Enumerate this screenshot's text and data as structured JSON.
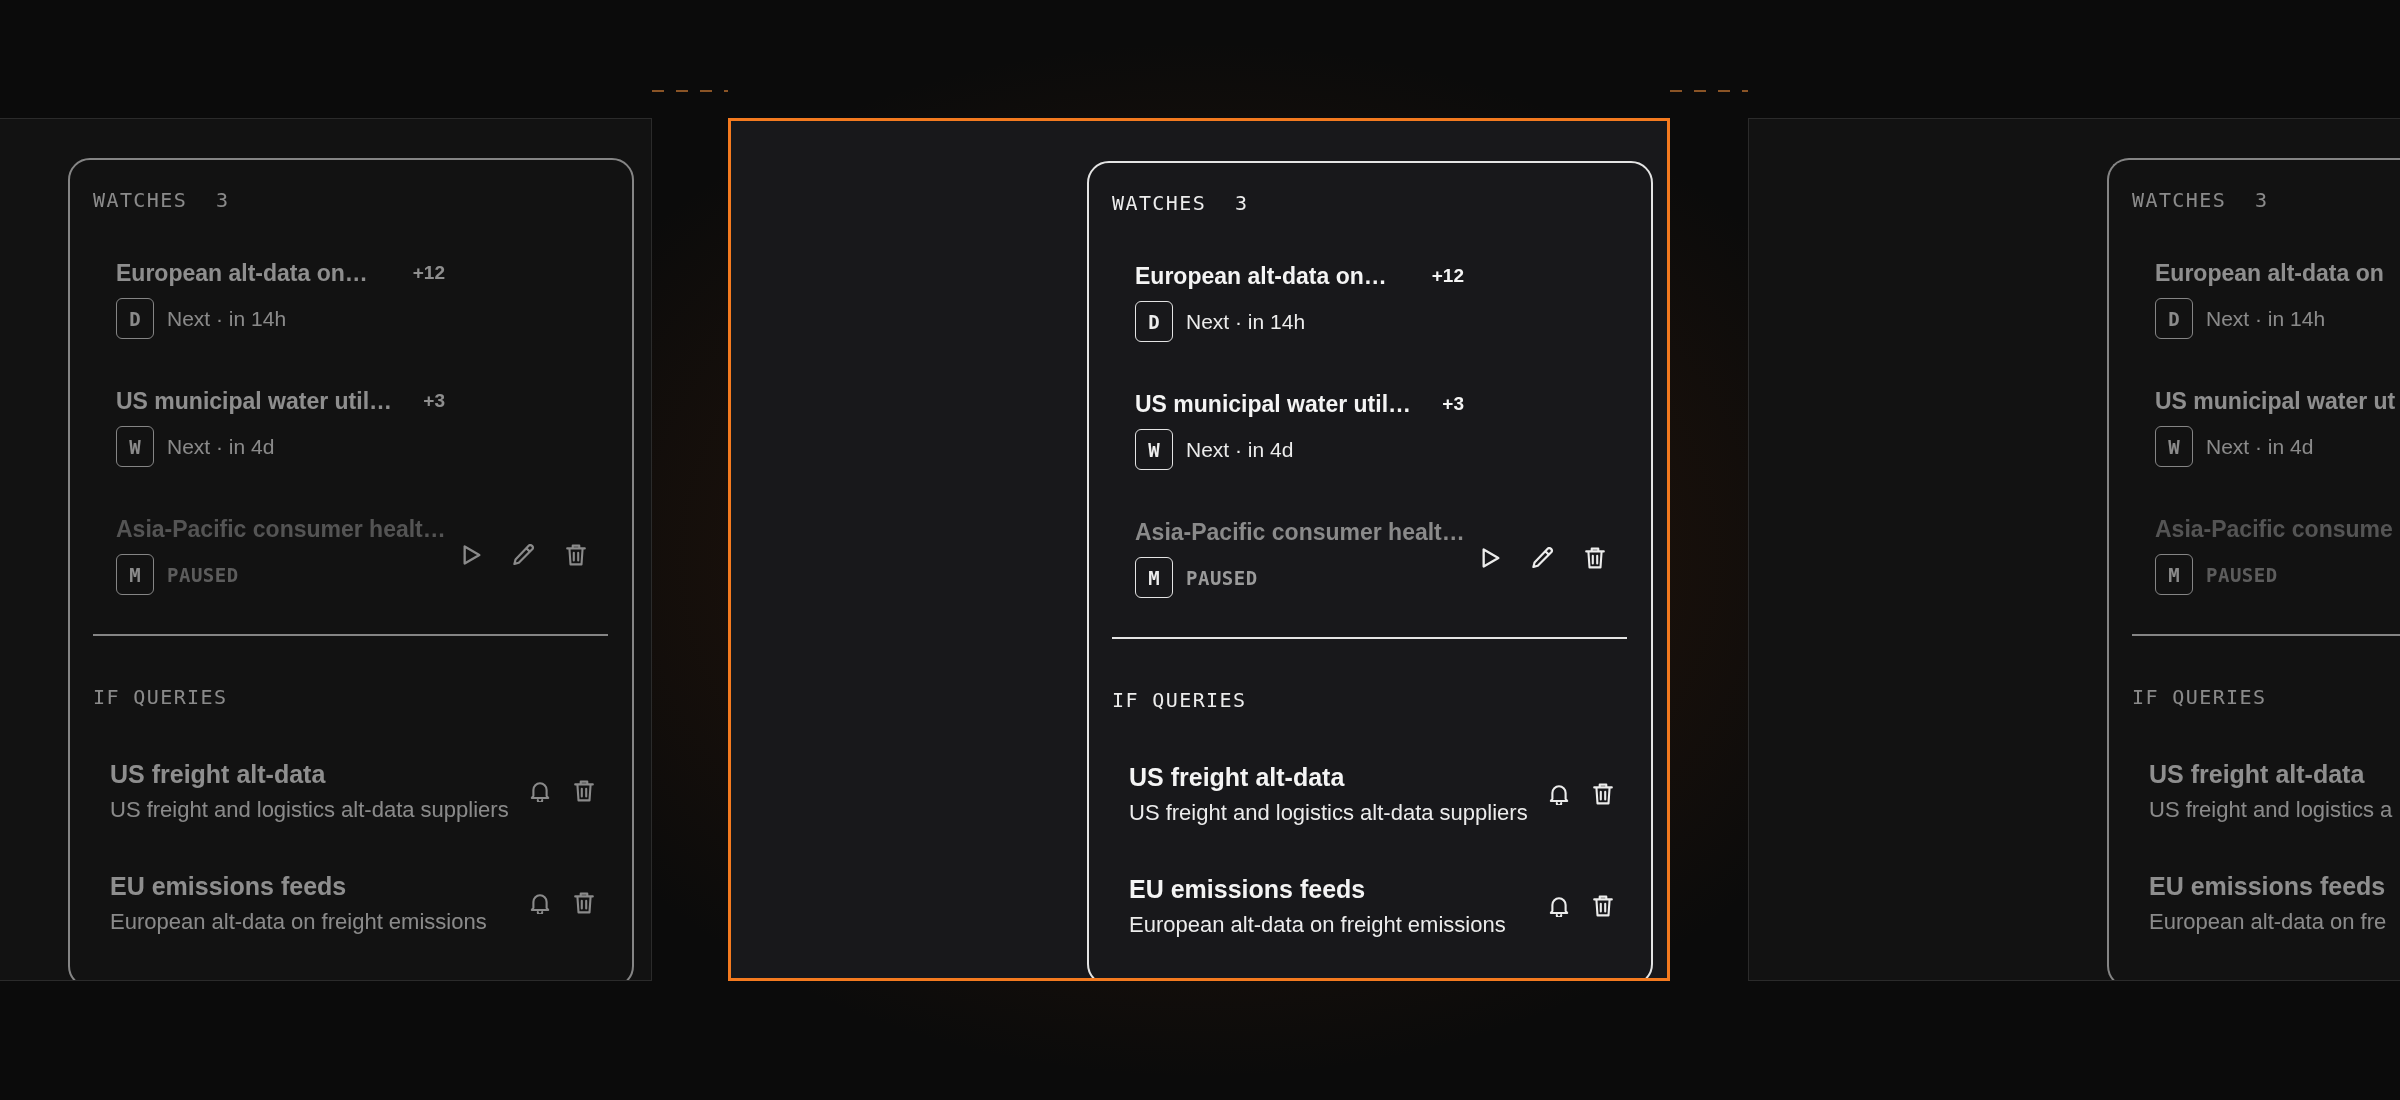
{
  "panels": [
    {
      "selected": false,
      "watches": {
        "title": "WATCHES",
        "count": "3",
        "items": [
          {
            "title": "European alt-data on…",
            "count": "+12",
            "badge": "D",
            "status": "Next · in 14h",
            "paused": false,
            "actions_shown": false
          },
          {
            "title": "US municipal water util…",
            "count": "+3",
            "badge": "W",
            "status": "Next · in 4d",
            "paused": false,
            "actions_shown": false
          },
          {
            "title": "Asia-Pacific consumer healt…",
            "badge": "M",
            "status": "PAUSED",
            "paused": true,
            "actions_shown": true
          }
        ]
      },
      "queries": {
        "title": "IF QUERIES",
        "items": [
          {
            "title": "US freight alt-data",
            "description": "US freight and logistics alt-data suppliers",
            "actions_shown": true
          },
          {
            "title": "EU emissions feeds",
            "description": "European alt-data on freight emissions",
            "actions_shown": true
          }
        ]
      }
    },
    {
      "selected": true,
      "watches": {
        "title": "WATCHES",
        "count": "3",
        "items": [
          {
            "title": "European alt-data on…",
            "count": "+12",
            "badge": "D",
            "status": "Next · in 14h",
            "paused": false,
            "actions_shown": false
          },
          {
            "title": "US municipal water util…",
            "count": "+3",
            "badge": "W",
            "status": "Next · in 4d",
            "paused": false,
            "actions_shown": false
          },
          {
            "title": "Asia-Pacific consumer healt…",
            "badge": "M",
            "status": "PAUSED",
            "paused": true,
            "actions_shown": true
          }
        ]
      },
      "queries": {
        "title": "IF QUERIES",
        "items": [
          {
            "title": "US freight alt-data",
            "description": "US freight and logistics alt-data suppliers",
            "actions_shown": true
          },
          {
            "title": "EU emissions feeds",
            "description": "European alt-data on freight emissions",
            "actions_shown": true
          }
        ]
      }
    },
    {
      "selected": false,
      "watches": {
        "title": "WATCHES",
        "count": "3",
        "items": [
          {
            "title": "European alt-data on",
            "badge": "D",
            "status": "Next · in 14h",
            "paused": false
          },
          {
            "title": "US municipal water ut",
            "badge": "W",
            "status": "Next · in 4d",
            "paused": false
          },
          {
            "title": "Asia-Pacific consume",
            "badge": "M",
            "status": "PAUSED",
            "paused": true
          }
        ]
      },
      "queries": {
        "title": "IF QUERIES",
        "items": [
          {
            "title": "US freight alt-data",
            "description": "US freight and logistics a"
          },
          {
            "title": "EU emissions feeds",
            "description": "European alt-data on fre"
          }
        ]
      }
    }
  ]
}
